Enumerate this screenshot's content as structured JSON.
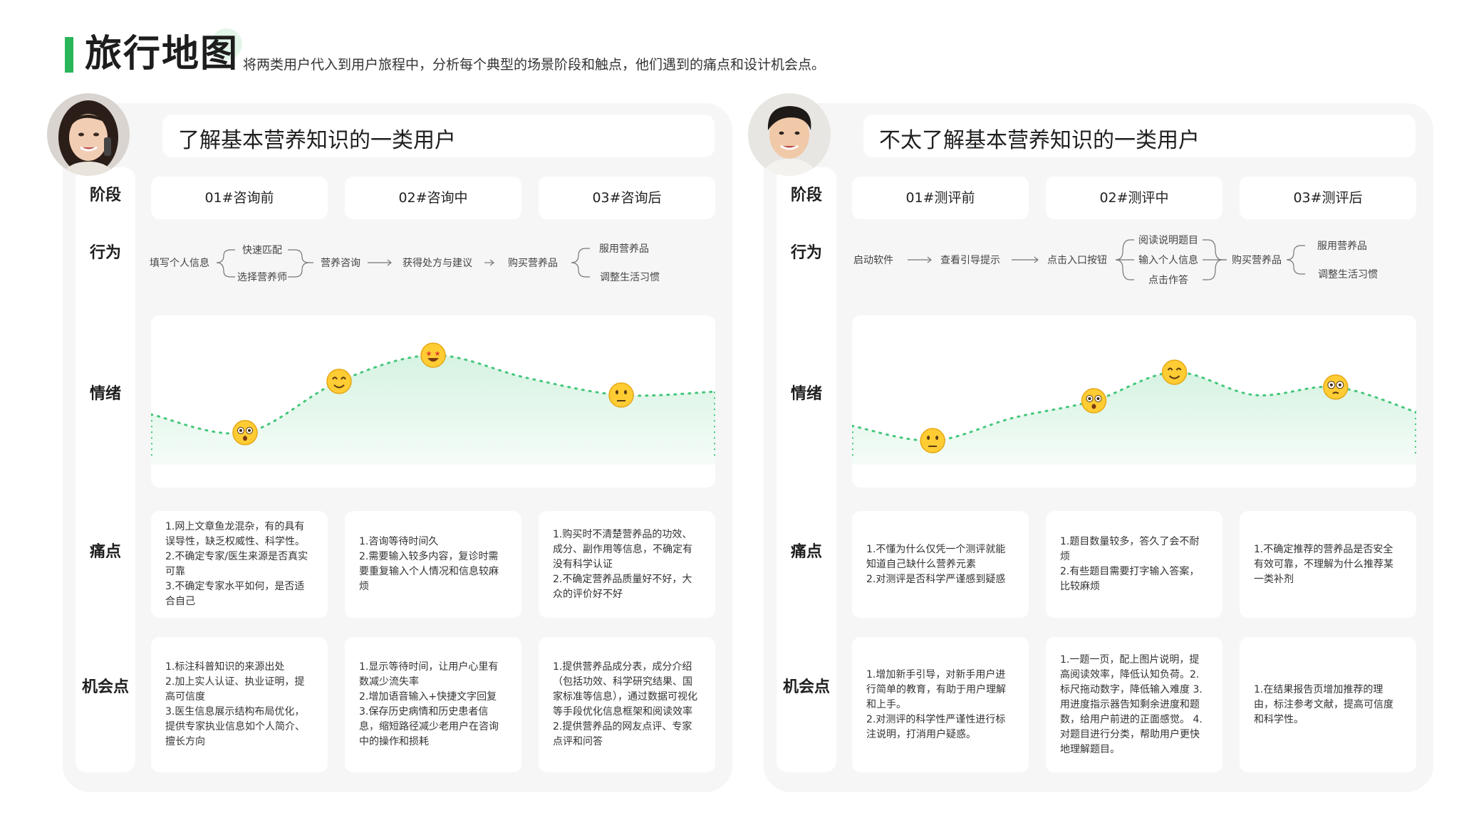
{
  "page": {
    "title": "旅行地图",
    "subtitle": "将两类用户代入到用户旅程中，分析每个典型的场景阶段和触点，他们遇到的痛点和设计机会点。"
  },
  "colors": {
    "accent": "#2bb55a",
    "curve": "#43c77a",
    "panel": "#f6f6f6"
  },
  "row_labels": {
    "stage": "阶段",
    "behavior": "行为",
    "emotion": "情绪",
    "pain": "痛点",
    "opportunity": "机会点"
  },
  "personas": [
    {
      "title": "了解基本营养知识的一类用户",
      "stages": [
        "01#咨询前",
        "02#咨询中",
        "03#咨询后"
      ],
      "behavior": {
        "nodes": [
          "填写个人信息",
          "快速匹配",
          "选择营养师",
          "营养咨询",
          "获得处方与建议",
          "购买营养品",
          "服用营养品",
          "调整生活习惯"
        ]
      },
      "emotion": {
        "levels": [
          0.38,
          0.22,
          0.67,
          0.9,
          0.7,
          0.55,
          0.58
        ],
        "emojis": [
          "flushed",
          "smile",
          "star-struck",
          "thinking"
        ]
      },
      "pain_points": [
        "1.网上文章鱼龙混杂，有的具有误导性，缺乏权威性、科学性。 2.不确定专家/医生来源是否真实可靠\n3.不确定专家水平如何，是否适合自己",
        "1.咨询等待时间久\n2.需要输入较多内容，复诊时需要重复输入个人情况和信息较麻烦",
        "1.购买时不清楚营养品的功效、成分、副作用等信息，不确定有没有科学认证\n2.不确定营养品质量好不好，大众的评价好不好"
      ],
      "opportunities": [
        "1.标注科普知识的来源出处\n2.加上实人认证、执业证明，提高可信度\n3.医生信息展示结构布局优化，提供专家执业信息如个人简介、擅长方向",
        "1.显示等待时间，让用户心里有数减少流失率\n2.增加语音输入+快捷文字回复\n3.保存历史病情和历史患者信息，缩短路径减少老用户在咨询中的操作和损耗",
        "1.提供营养品成分表，成分介绍（包括功效、科学研究结果、国家标准等信息），通过数据可视化等手段优化信息框架和阅读效率\n2.提供营养品的网友点评、专家点评和问答"
      ]
    },
    {
      "title": "不太了解基本营养知识的一类用户",
      "stages": [
        "01#测评前",
        "02#测评中",
        "03#测评后"
      ],
      "behavior": {
        "nodes": [
          "启动软件",
          "查看引导提示",
          "点击入口按钮",
          "阅读说明题目",
          "输入个人信息",
          "点击作答",
          "购买营养品",
          "服用营养品",
          "调整生活习惯"
        ]
      },
      "emotion": {
        "levels": [
          0.28,
          0.15,
          0.35,
          0.5,
          0.75,
          0.55,
          0.62,
          0.4
        ],
        "emojis": [
          "neutral",
          "hushed",
          "smile",
          "pleading"
        ]
      },
      "pain_points": [
        "1.不懂为什么仅凭一个测评就能知道自己缺什么营养元素\n2.对测评是否科学严谨感到疑惑",
        "1.题目数量较多，答久了会不耐烦\n2.有些题目需要打字输入答案，比较麻烦",
        "1.不确定推荐的营养品是否安全有效可靠，不理解为什么推荐某一类补剂"
      ],
      "opportunities": [
        "1.增加新手引导，对新手用户进行简单的教育，有助于用户理解和上手。\n2.对测评的科学性严谨性进行标注说明，打消用户疑惑。",
        "1.一题一页，配上图片说明，提高阅读效率，降低认知负荷。2. 标尺拖动数字，降低输入难度 3.用进度指示器告知剩余进度和题数，给用户前进的正面感觉。 4.对题目进行分类，帮助用户更快地理解题目。",
        "1.在结果报告页增加推荐的理由，标注参考文献，提高可信度和科学性。"
      ]
    }
  ]
}
